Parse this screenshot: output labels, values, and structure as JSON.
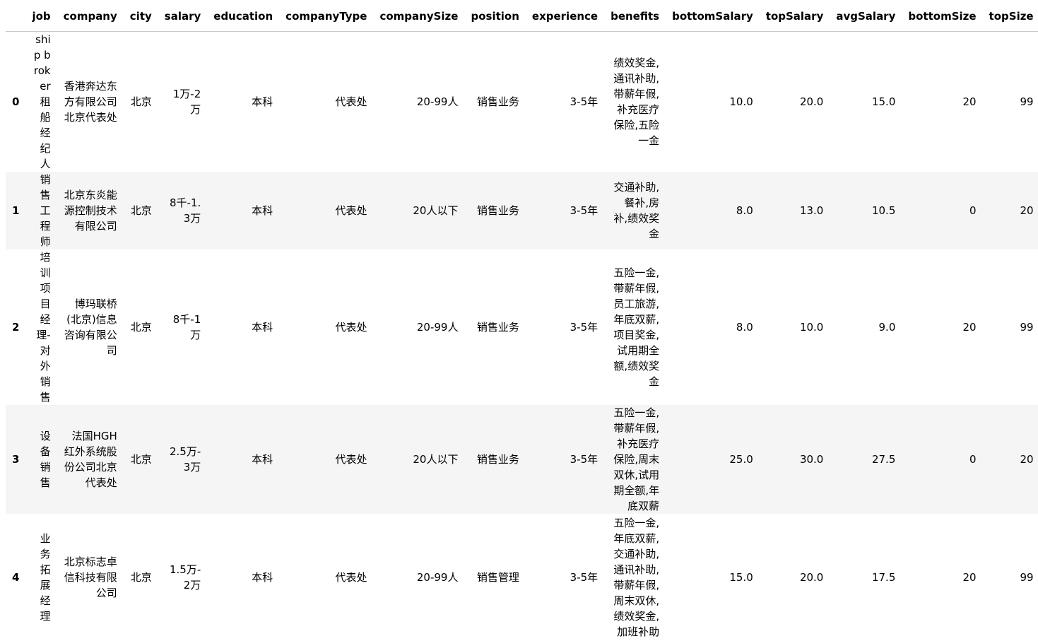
{
  "table": {
    "columns": [
      "job",
      "company",
      "city",
      "salary",
      "education",
      "companyType",
      "companySize",
      "position",
      "experience",
      "benefits",
      "bottomSalary",
      "topSalary",
      "avgSalary",
      "bottomSize",
      "topSize"
    ],
    "rows": [
      {
        "index": "0",
        "cells": [
          "ship broker 租船经纪人",
          "香港奔达东方有限公司北京代表处",
          "北京",
          "1万-2万",
          "本科",
          "代表处",
          "20-99人",
          "销售业务",
          "3-5年",
          "绩效奖金,通讯补助,带薪年假,补充医疗保险,五险一金",
          "10.0",
          "20.0",
          "15.0",
          "20",
          "99"
        ]
      },
      {
        "index": "1",
        "cells": [
          "销售工程师",
          "北京东炎能源控制技术有限公司",
          "北京",
          "8千-1.3万",
          "本科",
          "代表处",
          "20人以下",
          "销售业务",
          "3-5年",
          "交通补助,餐补,房补,绩效奖金",
          "8.0",
          "13.0",
          "10.5",
          "0",
          "20"
        ]
      },
      {
        "index": "2",
        "cells": [
          "培训项目经理-对外销售",
          "博玛联桥(北京)信息咨询有限公司",
          "北京",
          "8千-1万",
          "本科",
          "代表处",
          "20-99人",
          "销售业务",
          "3-5年",
          "五险一金,带薪年假,员工旅游,年底双薪,项目奖金,试用期全额,绩效奖金",
          "8.0",
          "10.0",
          "9.0",
          "20",
          "99"
        ]
      },
      {
        "index": "3",
        "cells": [
          "设备销售",
          "法国HGH红外系统股份公司北京代表处",
          "北京",
          "2.5万-3万",
          "本科",
          "代表处",
          "20人以下",
          "销售业务",
          "3-5年",
          "五险一金,带薪年假,补充医疗保险,周末双休,试用期全额,年底双薪",
          "25.0",
          "30.0",
          "27.5",
          "0",
          "20"
        ]
      },
      {
        "index": "4",
        "cells": [
          "业务拓展经理",
          "北京标志卓信科技有限公司",
          "北京",
          "1.5万-2万",
          "本科",
          "代表处",
          "20-99人",
          "销售管理",
          "3-5年",
          "五险一金,年底双薪,交通补助,通讯补助,带薪年假,周末双休,绩效奖金,加班补助",
          "15.0",
          "20.0",
          "17.5",
          "20",
          "99"
        ]
      }
    ]
  }
}
